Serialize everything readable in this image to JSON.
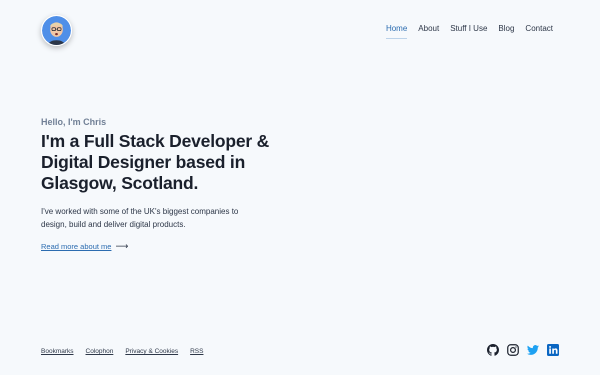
{
  "nav": {
    "items": [
      {
        "label": "Home",
        "active": true
      },
      {
        "label": "About",
        "active": false
      },
      {
        "label": "Stuff I Use",
        "active": false
      },
      {
        "label": "Blog",
        "active": false
      },
      {
        "label": "Contact",
        "active": false
      }
    ]
  },
  "hero": {
    "greeting": "Hello, I'm Chris",
    "headline": "I'm a Full Stack Developer & Digital Designer based in Glasgow, Scotland.",
    "intro": "I've worked with some of the UK's biggest companies to design, build and deliver digital products.",
    "read_more": "Read more about me",
    "arrow": "⟶"
  },
  "footer": {
    "links": [
      "Bookmarks",
      "Colophon",
      "Privacy & Cookies",
      "RSS"
    ],
    "social": [
      "github-icon",
      "instagram-icon",
      "twitter-icon",
      "linkedin-icon"
    ]
  },
  "colors": {
    "background": "#f6f9fc",
    "accent": "#2b6cb0",
    "twitter": "#1da1f2",
    "linkedin": "#0a66c2"
  }
}
